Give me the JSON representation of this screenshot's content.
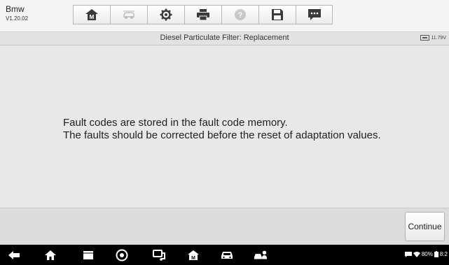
{
  "app": {
    "name": "Bmw",
    "version": "V1.20.02"
  },
  "toolbar": {
    "buttons": [
      {
        "name": "home-icon",
        "state": "active"
      },
      {
        "name": "vehicle-swap-icon",
        "state": "disabled"
      },
      {
        "name": "settings-icon",
        "state": "active"
      },
      {
        "name": "print-icon",
        "state": "active"
      },
      {
        "name": "help-icon",
        "state": "disabled"
      },
      {
        "name": "save-icon",
        "state": "active"
      },
      {
        "name": "message-icon",
        "state": "active"
      }
    ]
  },
  "title_bar": {
    "title": "Diesel Particulate Filter: Replacement",
    "battery_voltage": "11.79V"
  },
  "message": {
    "line1": "Fault codes are stored in the fault code memory.",
    "line2": "The faults should be corrected before the reset of adaptation values."
  },
  "actions": {
    "continue_label": "Continue"
  },
  "nav_bar": {
    "icons": [
      "back-icon",
      "home-icon",
      "recent-apps-icon",
      "chrome-icon",
      "vci-icon",
      "maxisys-home-icon",
      "vehicle-icon",
      "service-icon"
    ],
    "battery_percent": "80%",
    "time": "8:2"
  },
  "colors": {
    "background": "#e8e8e8",
    "toolbar": "#f4f4f4",
    "nav_bar": "#000000"
  }
}
